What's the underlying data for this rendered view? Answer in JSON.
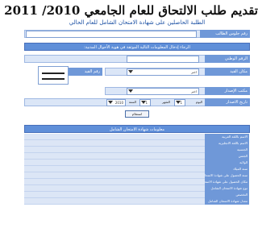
{
  "header": {
    "title": "تقديم طلب الالتحاق للعام الجامعي 2010/ 2011",
    "subtitle": "الطلبة الحاصلين على شهادة الامتحان الشامل للعام الحالي"
  },
  "student_number": {
    "label": "رقم جلوس الطالب"
  },
  "notice": {
    "text": "الرجاء إدخال المعلومات التالية الموثقة في هوية الأحوال المدنية:"
  },
  "form": {
    "national_id_label": "الرقم الوطني",
    "id_number_label": "رقم القيد",
    "place_id_label": "مكان القيد",
    "issue_place_label": "مكتب الإصدار",
    "birth_date_label": "تاريخ الاصدار",
    "select_default": "اختر",
    "day_label": "اليوم",
    "month_label": "الشهر",
    "year_label": "السنة",
    "day_value": "1",
    "month_value": "1",
    "year_value": "2010",
    "submit_label": "استعلام"
  },
  "results": {
    "section_title": "معلومات شهادة الامتحان الشامل",
    "rows": [
      "الاسم باللغة العربية",
      "الاسم باللغة الانجليزية",
      "الجنسية",
      "الجنس",
      "الولاية",
      "سنة الميلاد",
      "سنة الحصول على شهادة الامتحان الشامل",
      "مكان الحصول على شهادة الامتحان الشامل",
      "نوع شهادة الامتحان الشامل",
      "التخصص",
      "معدل شهادة الامتحان الشامل"
    ]
  },
  "colors": {
    "label_bg": "#6f98d8",
    "row_bg": "#dce6f6",
    "accent": "#5f8fd9",
    "subtitle": "#1a4fa3"
  }
}
